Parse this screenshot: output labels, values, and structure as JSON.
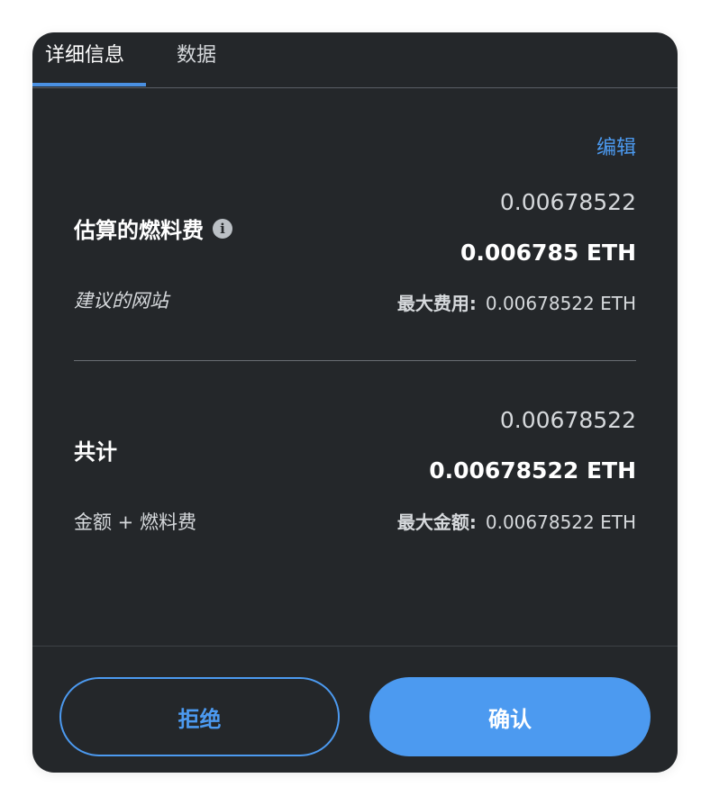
{
  "tabs": [
    {
      "label": "详细信息",
      "active": true
    },
    {
      "label": "数据",
      "active": false
    }
  ],
  "edit_label": "编辑",
  "gas": {
    "label": "估算的燃料费",
    "sub_label": "建议的网站",
    "primary_value": "0.00678522",
    "secondary_value": "0.006785 ETH",
    "max_label": "最大费用:",
    "max_value": "0.00678522 ETH"
  },
  "total": {
    "label": "共计",
    "sub_label": "金额 + 燃料费",
    "primary_value": "0.00678522",
    "secondary_value": "0.00678522 ETH",
    "max_label": "最大金额:",
    "max_value": "0.00678522 ETH"
  },
  "buttons": {
    "reject": "拒绝",
    "confirm": "确认"
  },
  "colors": {
    "background": "#24272a",
    "accent": "#4c9af0"
  },
  "icons": {
    "info": "info-icon"
  }
}
